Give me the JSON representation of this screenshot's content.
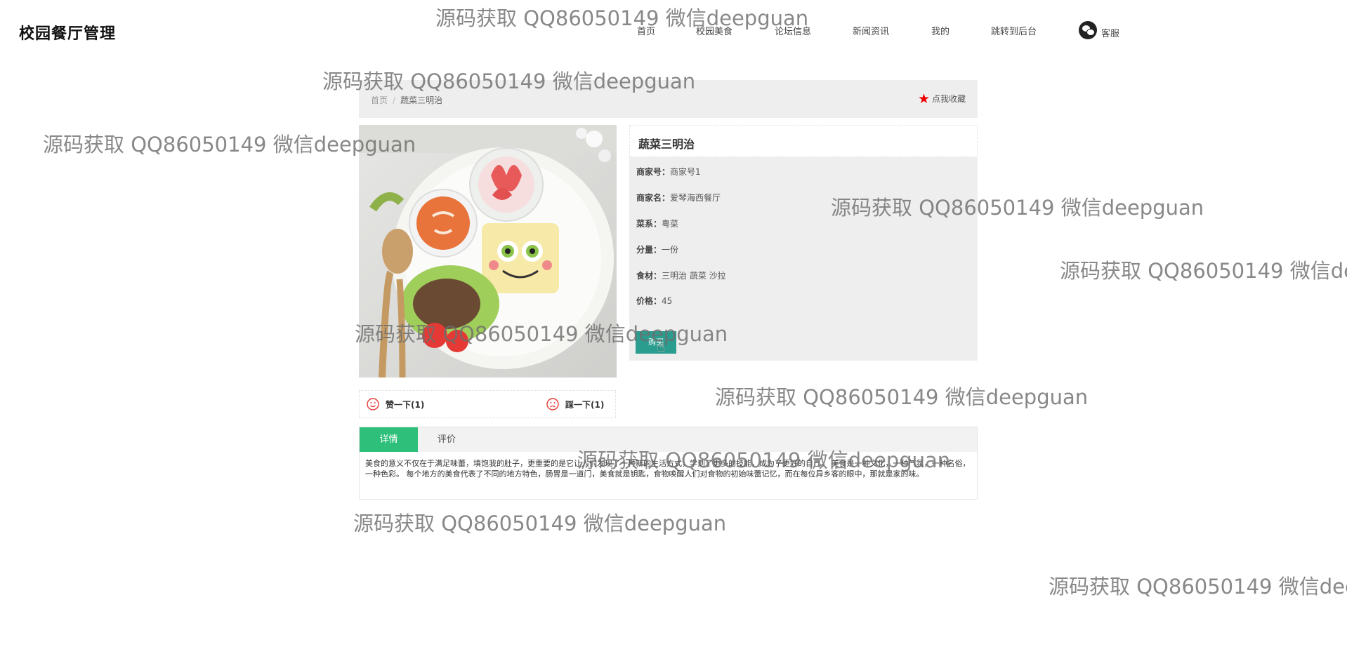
{
  "header": {
    "site_title": "校园餐厅管理",
    "nav": [
      "首页",
      "校园美食",
      "论坛信息",
      "新闻资讯",
      "我的",
      "跳转到后台"
    ],
    "customer_service": "客服"
  },
  "breadcrumb": {
    "home": "首页",
    "separator": "/",
    "current": "蔬菜三明治"
  },
  "favorite": {
    "star": "★",
    "label": "点我收藏"
  },
  "product": {
    "name": "蔬菜三明治",
    "fields": [
      {
        "key": "商家号：",
        "value": "商家号1"
      },
      {
        "key": "商家名：",
        "value": "爱琴海西餐厅"
      },
      {
        "key": "菜系：",
        "value": "粤菜"
      },
      {
        "key": "分量：",
        "value": "一份"
      },
      {
        "key": "食材：",
        "value": "三明治 蔬菜 沙拉"
      },
      {
        "key": "价格：",
        "value": "45"
      }
    ],
    "buy_button": "购买"
  },
  "votes": {
    "like": "赞一下(1)",
    "dislike": "踩一下(1)"
  },
  "tabs": {
    "detail": "详情",
    "comments": "评价"
  },
  "detail_text": "美食的意义不仅在于满足味蕾，填饱我的肚子，更重要的是它让人们发现了一种新的生活方式，学到了更多的技能，成为了更好的自己。 美食是一种文化，一种气氛，一种名俗，一种色彩。 每个地方的美食代表了不同的地方特色，肠胃是一道门，美食就是钥匙，食物唤醒人们对食物的初始味蕾记忆，而在每位异乡客的眼中，那就是家的味。",
  "watermark": "源码获取 QQ86050149 微信deepguan",
  "colors": {
    "accent_green": "#2ec07a",
    "button_teal": "#2a9d8f",
    "star_red": "#e00000",
    "panel_gray": "#eeeeee"
  }
}
